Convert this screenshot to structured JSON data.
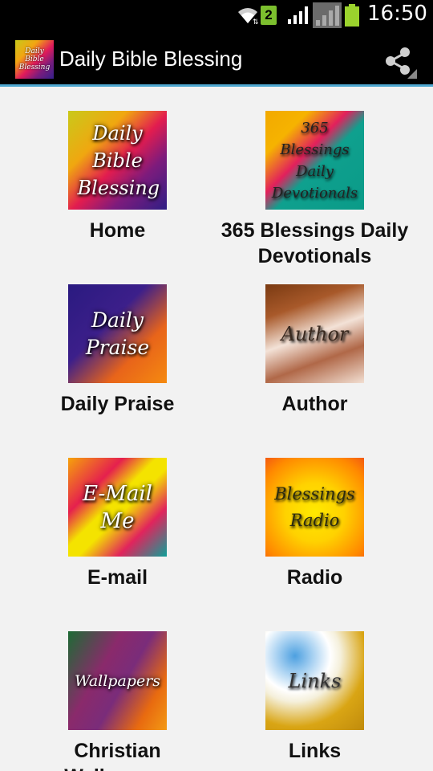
{
  "status_bar": {
    "time": "16:50",
    "notification_count": "2",
    "wifi_icon": "wifi-icon",
    "signal_icon": "signal-icon",
    "battery_icon": "battery-icon"
  },
  "action_bar": {
    "title": "Daily Bible Blessing",
    "app_icon_text": "Daily Bible Blessing",
    "share_icon": "share-icon",
    "accent_color": "#4fa8d1"
  },
  "tiles": [
    {
      "image_text": "Daily Bible Blessing",
      "label": "Home"
    },
    {
      "image_text": "365 Blessings Daily Devotionals",
      "label": "365 Blessings Daily Devotionals"
    },
    {
      "image_text": "Daily Praise",
      "label": "Daily Praise"
    },
    {
      "image_text": "Author",
      "label": "Author"
    },
    {
      "image_text": "E-Mail Me",
      "label": "E-mail"
    },
    {
      "image_text": "Blessings Radio",
      "label": "Radio"
    },
    {
      "image_text": "Wallpapers",
      "label": "Christian Wallpapers"
    },
    {
      "image_text": "Links",
      "label": "Links"
    }
  ]
}
